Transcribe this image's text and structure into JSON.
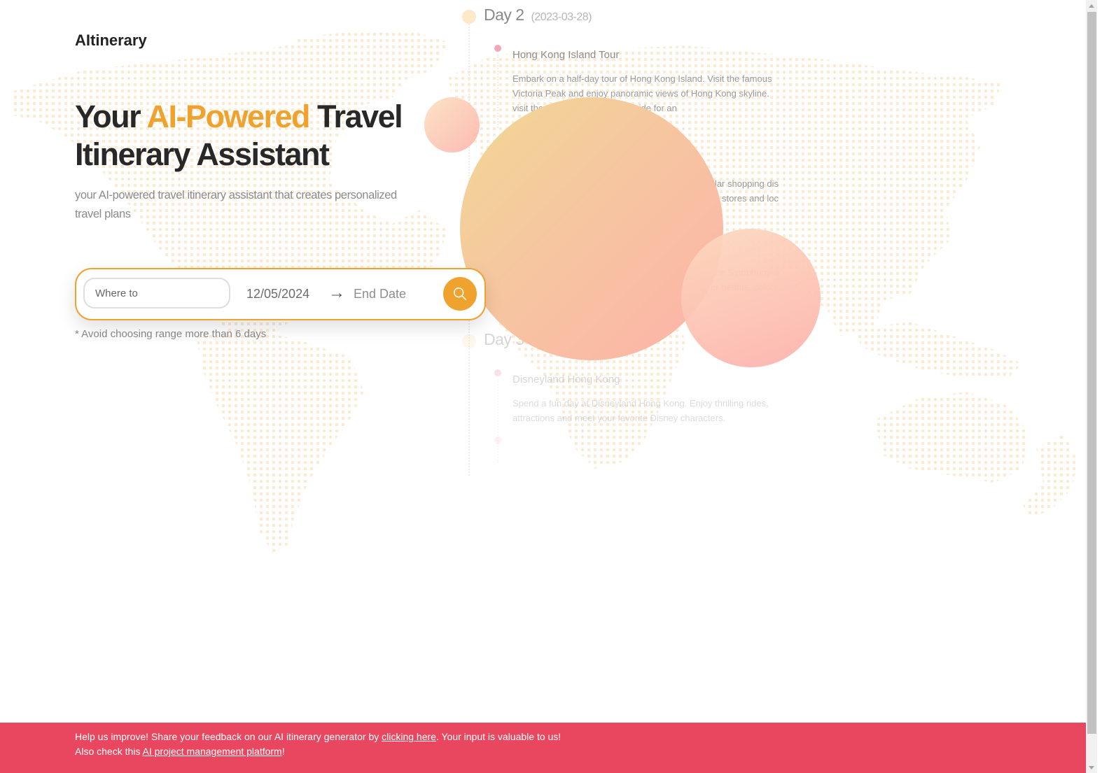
{
  "brand": {
    "name": "AItinerary"
  },
  "hero": {
    "title_prefix": "Your ",
    "title_accent": "AI-Powered",
    "title_suffix": " Travel Itinerary Assistant",
    "subtitle": "your AI-powered travel itinerary assistant that creates personalized travel plans",
    "accent_color": "#f0a22e"
  },
  "search": {
    "destination_placeholder": "Where to",
    "destination_value": "",
    "start_date": "12/05/2024",
    "arrow": "→",
    "end_date_placeholder": "End Date",
    "search_icon": "search-icon",
    "hint": "* Avoid choosing range more than 6 days"
  },
  "itinerary_preview": {
    "days": [
      {
        "label": "Day 2",
        "date": "(2023-03-28)",
        "activities": [
          {
            "title": "Hong Kong Island Tour",
            "description_lines": [
              "Embark on a half-day tour of Hong Kong Island. Visit the famous",
              "Victoria Peak and enjoy panoramic views of Hong Kong skyline.",
              "visit the ... and take a sampan ride for an"
            ]
          },
          {
            "title": "",
            "description_lines": [
              "...lar shopping dis",
              "... stores and loc"
            ]
          },
          {
            "title": "",
            "description_lines": [
              "...the Symphony o",
              "...er beams, colore"
            ]
          }
        ]
      },
      {
        "label": "Day 3",
        "date": "",
        "activities": [
          {
            "title": "Disneyland Hong Kong",
            "description_lines": [
              "Spend a fun day at Disneyland Hong Kong. Enjoy thrilling rides,",
              "attractions and meet your favorite Disney characters."
            ]
          }
        ]
      }
    ]
  },
  "footer": {
    "line1_before": "Help us improve! Share your feedback on our AI itinerary generator by ",
    "line1_link": "clicking here",
    "line1_after": ". Your input is valuable to us!",
    "line2_before": "Also check this ",
    "line2_link": "AI project management platform",
    "line2_after": "!",
    "background_color": "#e8475f"
  }
}
